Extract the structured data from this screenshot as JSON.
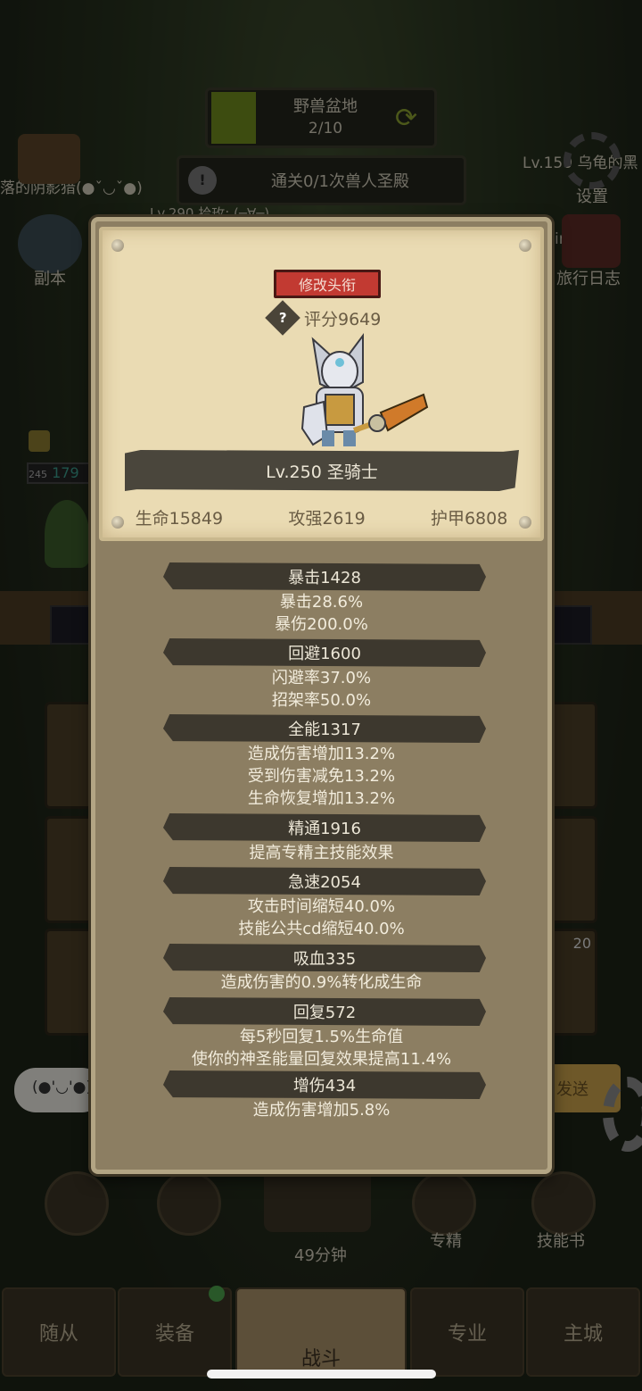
{
  "background": {
    "area_name": "野兽盆地",
    "area_progress": "2/10",
    "quest_text": "通关0/1次兽人圣殿",
    "left_top_text": "落的阴影猎(●ˇ◡ˇ●)",
    "left_level_text": "Lv.290 拾玫: (─∀─)",
    "right_top_text": "Lv.150 乌龟的黑",
    "right_name_text": "ingdalu",
    "left_menu_label": "副本",
    "settings_label": "设置",
    "travel_log_label": "旅行日志",
    "hp_level": "245",
    "hp_value": "179",
    "chat_emoticon": "(●'◡'●)",
    "send_label": "发送",
    "badge_count": "20",
    "timer_label": "49分钟",
    "specialty_label": "专精",
    "skillbook_label": "技能书",
    "tabs": [
      "随从",
      "装备",
      "战斗",
      "专业",
      "主城"
    ]
  },
  "panel": {
    "rename_label": "修改头衔",
    "score_label": "评分9649",
    "help_icon": "?",
    "level_class": "Lv.250 圣骑士",
    "base_stats": [
      "生命15849",
      "攻强2619",
      "护甲6808"
    ],
    "stat_groups": [
      {
        "header": "暴击1428",
        "lines": [
          "暴击28.6%",
          "暴伤200.0%"
        ]
      },
      {
        "header": "回避1600",
        "lines": [
          "闪避率37.0%",
          "招架率50.0%"
        ]
      },
      {
        "header": "全能1317",
        "lines": [
          "造成伤害增加13.2%",
          "受到伤害减免13.2%",
          "生命恢复增加13.2%"
        ]
      },
      {
        "header": "精通1916",
        "lines": [
          "提高专精主技能效果"
        ]
      },
      {
        "header": "急速2054",
        "lines": [
          "攻击时间缩短40.0%",
          "技能公共cd缩短40.0%"
        ]
      },
      {
        "header": "吸血335",
        "lines": [
          "造成伤害的0.9%转化成生命"
        ]
      },
      {
        "header": "回复572",
        "lines": [
          "每5秒回复1.5%生命值",
          "使你的神圣能量回复效果提高11.4%"
        ]
      },
      {
        "header": "增伤434",
        "lines": [
          "造成伤害增加5.8%"
        ]
      }
    ]
  }
}
